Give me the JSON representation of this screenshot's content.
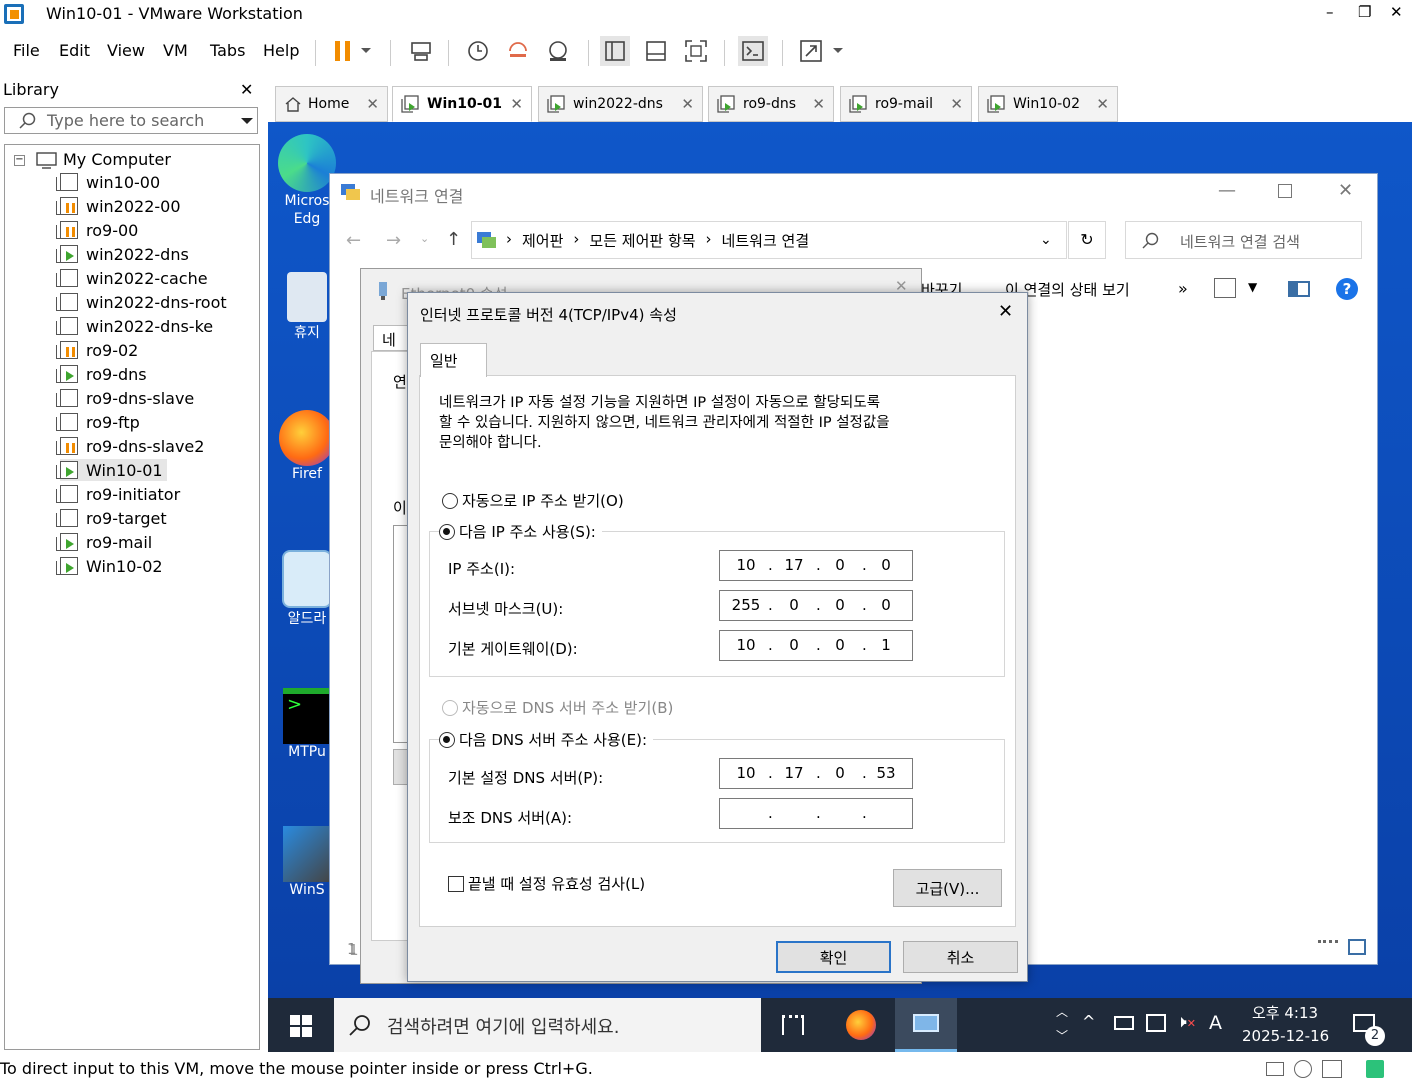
{
  "window": {
    "title": "Win10-01 - VMware Workstation",
    "min": "–",
    "max": "❐",
    "close": "✕"
  },
  "menu": [
    "File",
    "Edit",
    "View",
    "VM",
    "Tabs",
    "Help"
  ],
  "library": {
    "title": "Library",
    "close": "✕",
    "search_placeholder": "Type here to search",
    "root": "My Computer",
    "items": [
      "win10-00",
      "win2022-00",
      "ro9-00",
      "win2022-dns",
      "win2022-cache",
      "win2022-dns-root",
      "win2022-dns-ke",
      "ro9-02",
      "ro9-dns",
      "ro9-dns-slave",
      "ro9-ftp",
      "ro9-dns-slave2",
      "Win10-01",
      "ro9-initiator",
      "ro9-target",
      "ro9-mail",
      "Win10-02"
    ]
  },
  "tabs": [
    {
      "label": "Home"
    },
    {
      "label": "Win10-01"
    },
    {
      "label": "win2022-dns"
    },
    {
      "label": "ro9-dns"
    },
    {
      "label": "ro9-mail"
    },
    {
      "label": "Win10-02"
    }
  ],
  "desktop": {
    "icons": [
      "Micros\nEdg",
      "휴지",
      "Firef",
      "알드라",
      "MTPu",
      "WinS"
    ]
  },
  "explorer": {
    "title": "네트워크 연결",
    "crumbs": [
      "제어판",
      "모든 제어판 항목",
      "네트워크 연결"
    ],
    "search_placeholder": "네트워크 연결 검색",
    "cmd1": "바꾸기",
    "cmd2": "이 연결의 상태 보기",
    "more": "»"
  },
  "ethernet": {
    "title": "Ethernet0 속성",
    "tab": "네",
    "row1": "연",
    "row2": "이",
    "bottom": "1"
  },
  "ipv4": {
    "title": "인터넷 프로토콜 버전 4(TCP/IPv4) 속성",
    "tab": "일반",
    "intro": "네트워크가 IP 자동 설정 기능을 지원하면 IP 설정이 자동으로 할당되도록\n할 수 있습니다. 지원하지 않으면, 네트워크 관리자에게 적절한 IP 설정값을\n문의해야 합니다.",
    "auto_ip": "자동으로 IP 주소 받기(O)",
    "manual_ip": "다음 IP 주소 사용(S):",
    "ip_label": "IP 주소(I):",
    "ip": [
      "10",
      "17",
      "0",
      "0"
    ],
    "mask_label": "서브넷 마스크(U):",
    "mask": [
      "255",
      "0",
      "0",
      "0"
    ],
    "gw_label": "기본 게이트웨이(D):",
    "gw": [
      "10",
      "0",
      "0",
      "1"
    ],
    "auto_dns": "자동으로 DNS 서버 주소 받기(B)",
    "manual_dns": "다음 DNS 서버 주소 사용(E):",
    "dns1_label": "기본 설정 DNS 서버(P):",
    "dns1": [
      "10",
      "17",
      "0",
      "53"
    ],
    "dns2_label": "보조 DNS 서버(A):",
    "dns2": [
      "",
      "",
      "",
      ""
    ],
    "validate": "끝낼 때 설정 유효성 검사(L)",
    "advanced": "고급(V)...",
    "ok": "확인",
    "cancel": "취소"
  },
  "taskbar": {
    "search": "검색하려면 여기에 입력하세요.",
    "time": "오후 4:13",
    "date": "2025-12-16",
    "ime": "A",
    "notif": "2"
  },
  "status": "To direct input to this VM, move the mouse pointer inside or press Ctrl+G."
}
